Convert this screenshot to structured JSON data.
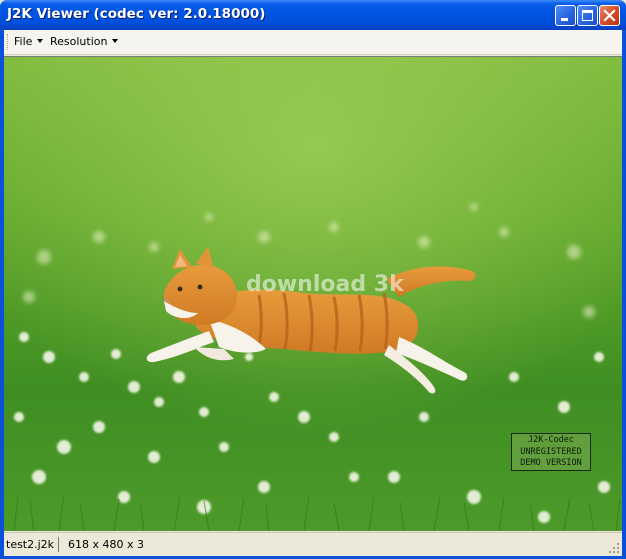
{
  "window": {
    "title": "J2K Viewer (codec ver: 2.0.18000)"
  },
  "titlebar_buttons": {
    "minimize": "minimize-icon",
    "maximize": "maximize-icon",
    "close": "close-icon"
  },
  "menu": {
    "items": [
      {
        "label": "File"
      },
      {
        "label": "Resolution"
      }
    ]
  },
  "image": {
    "subject": "kitten running on grass",
    "watermark_text": "download 3k",
    "badge_lines": [
      "J2K-Codec",
      "UNREGISTERED",
      "DEMO VERSION"
    ]
  },
  "status": {
    "filename": "test2.j2k",
    "dimensions": "618 x 480 x 3"
  },
  "colors": {
    "titlebar": "#0054e3",
    "close_button": "#d44a26",
    "chrome": "#ece9d8",
    "grass": "#4d9a28"
  }
}
